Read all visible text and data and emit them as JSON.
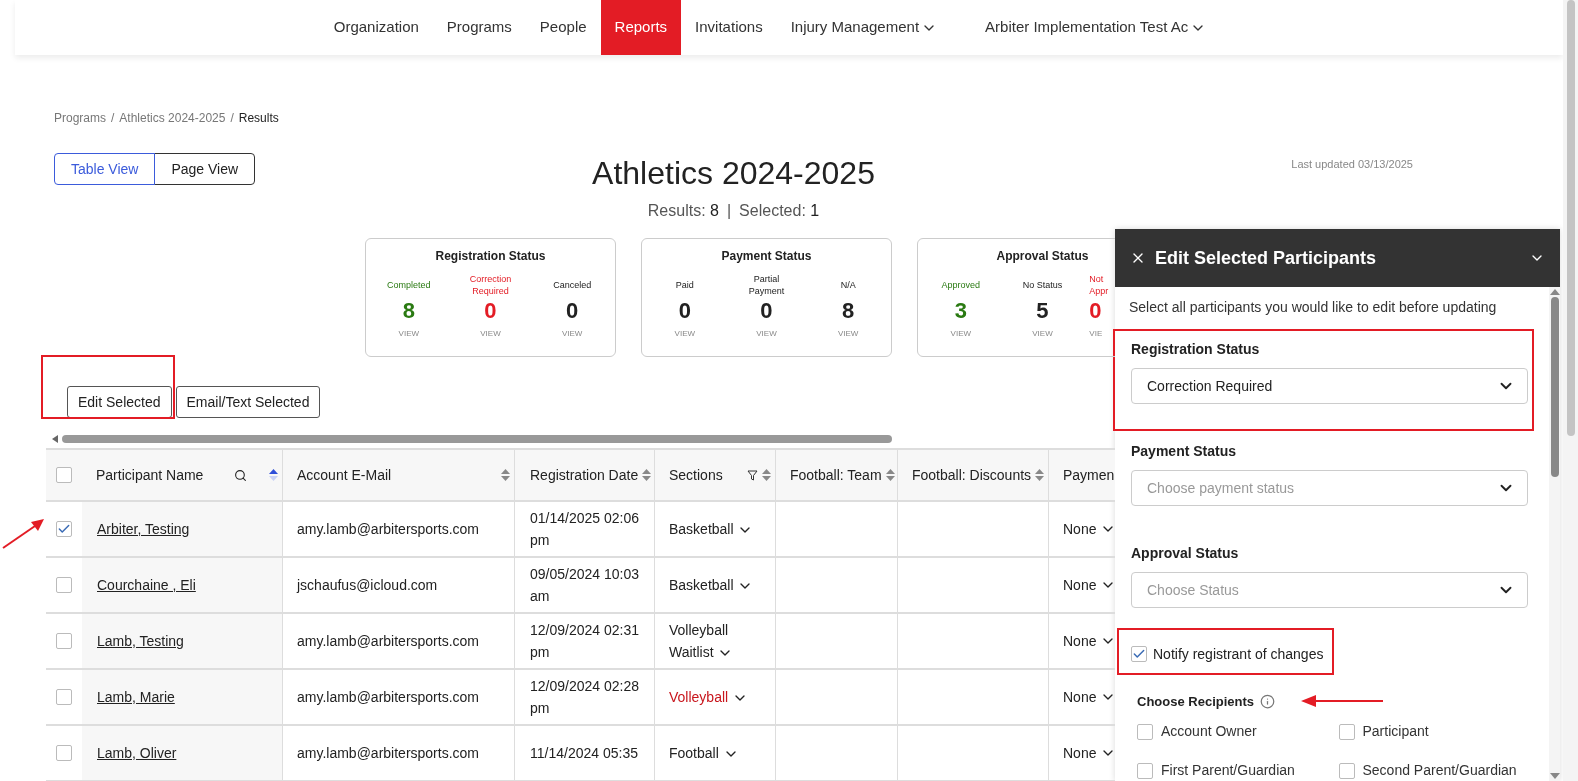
{
  "nav": {
    "items": [
      {
        "label": "Organization",
        "selected": false,
        "has_menu": false
      },
      {
        "label": "Programs",
        "selected": false,
        "has_menu": false
      },
      {
        "label": "People",
        "selected": false,
        "has_menu": false
      },
      {
        "label": "Reports",
        "selected": true,
        "has_menu": false
      },
      {
        "label": "Invitations",
        "selected": false,
        "has_menu": false
      },
      {
        "label": "Injury Management",
        "selected": false,
        "has_menu": true
      },
      {
        "label": "Arbiter Implementation Test Ac",
        "selected": false,
        "has_menu": true
      }
    ]
  },
  "breadcrumb": [
    {
      "label": "Programs",
      "separator": "/"
    },
    {
      "label": "Athletics 2024-2025",
      "separator": "/"
    },
    {
      "label": "Results"
    }
  ],
  "view_toggle": [
    {
      "label": "Table View",
      "selected": true
    },
    {
      "label": "Page View",
      "selected": false
    }
  ],
  "title": "Athletics 2024-2025",
  "last_updated": "Last updated 03/13/2025",
  "summary": {
    "results_label": "Results:",
    "results": "8",
    "separator": "|",
    "selected_label": "Selected:",
    "selected": "1"
  },
  "stat_cards": [
    {
      "title": "Registration Status",
      "stats": [
        {
          "label": "Completed",
          "value": "8",
          "color": "#2a7a12",
          "link": "VIEW",
          "cut_off": false
        },
        {
          "label": "Correction Required",
          "value": "0",
          "color": "#e31c25",
          "link": "VIEW",
          "cut_off": false
        },
        {
          "label": "Canceled",
          "value": "0",
          "color": "#222222",
          "link": "VIEW",
          "cut_off": false
        }
      ]
    },
    {
      "title": "Payment Status",
      "stats": [
        {
          "label": "Paid",
          "value": "0",
          "color": "#222222",
          "link": "VIEW",
          "cut_off": false
        },
        {
          "label": "Partial Payment",
          "value": "0",
          "color": "#222222",
          "link": "VIEW",
          "cut_off": false
        },
        {
          "label": "N/A",
          "value": "8",
          "color": "#222222",
          "link": "VIEW",
          "cut_off": false
        }
      ]
    },
    {
      "title": "Approval Status",
      "stats": [
        {
          "label": "Approved",
          "value": "3",
          "color": "#2a7a12",
          "link": "VIEW",
          "cut_off": false
        },
        {
          "label": "No Status",
          "value": "5",
          "color": "#222222",
          "link": "VIEW",
          "cut_off": false
        },
        {
          "label": "Not Appr",
          "value": "0",
          "color": "#e31c25",
          "link": "VIE",
          "cut_off": true
        }
      ]
    }
  ],
  "actions": [
    "Edit Selected",
    "Email/Text Selected"
  ],
  "table": {
    "header_checked": false,
    "columns": [
      {
        "label": "Participant Name",
        "search": true,
        "filter": false,
        "sort_icon": true,
        "sorted": true
      },
      {
        "label": "Account E-Mail",
        "search": false,
        "filter": false,
        "sort_icon": true,
        "sorted": false
      },
      {
        "label": "Registration Date",
        "search": false,
        "filter": false,
        "sort_icon": true,
        "sorted": false
      },
      {
        "label": "Sections",
        "search": false,
        "filter": true,
        "sort_icon": true,
        "sorted": false
      },
      {
        "label": "Football: Team",
        "search": false,
        "filter": false,
        "sort_icon": true,
        "sorted": false
      },
      {
        "label": "Football: Discounts",
        "search": false,
        "filter": false,
        "sort_icon": true,
        "sorted": false
      },
      {
        "label": "Paymen"
      }
    ],
    "rows": [
      {
        "checked": true,
        "name": "Arbiter, Testing",
        "email": "amy.lamb@arbitersports.com",
        "date": "01/14/2025 02:06 pm",
        "section": "Basketball",
        "section_alert": false,
        "payment": "None"
      },
      {
        "checked": false,
        "name": "Courchaine , Eli",
        "email": "jschaufus@icloud.com",
        "date": "09/05/2024 10:03 am",
        "section": "Basketball",
        "section_alert": false,
        "payment": "None"
      },
      {
        "checked": false,
        "name": "Lamb, Testing",
        "email": "amy.lamb@arbitersports.com",
        "date": "12/09/2024 02:31 pm",
        "section": "Volleyball Waitlist",
        "section_alert": false,
        "payment": "None"
      },
      {
        "checked": false,
        "name": "Lamb, Marie",
        "email": "amy.lamb@arbitersports.com",
        "date": "12/09/2024 02:28 pm",
        "section": "Volleyball",
        "section_alert": true,
        "payment": "None"
      },
      {
        "checked": false,
        "name": "Lamb, Oliver",
        "email": "amy.lamb@arbitersports.com",
        "date": "11/14/2024 05:35",
        "section": "Football",
        "section_alert": false,
        "payment": "None"
      }
    ]
  },
  "panel": {
    "title": "Edit Selected Participants",
    "description": "Select all participants you would like to edit before updating",
    "fields": [
      {
        "label": "Registration Status",
        "value": "Correction Required",
        "highlighted": true
      },
      {
        "label": "Payment Status",
        "placeholder": "Choose payment status",
        "highlighted": false
      },
      {
        "label": "Approval Status",
        "placeholder": "Choose Status",
        "highlighted": false
      }
    ],
    "notify": {
      "label": "Notify registrant of changes",
      "checked": true
    },
    "recipients": {
      "title": "Choose Recipients",
      "options": [
        {
          "label": "Account Owner",
          "checked": false
        },
        {
          "label": "Participant",
          "checked": false
        },
        {
          "label": "First Parent/Guardian",
          "checked": false
        },
        {
          "label": "Second Parent/Guardian",
          "checked": false
        }
      ]
    }
  }
}
